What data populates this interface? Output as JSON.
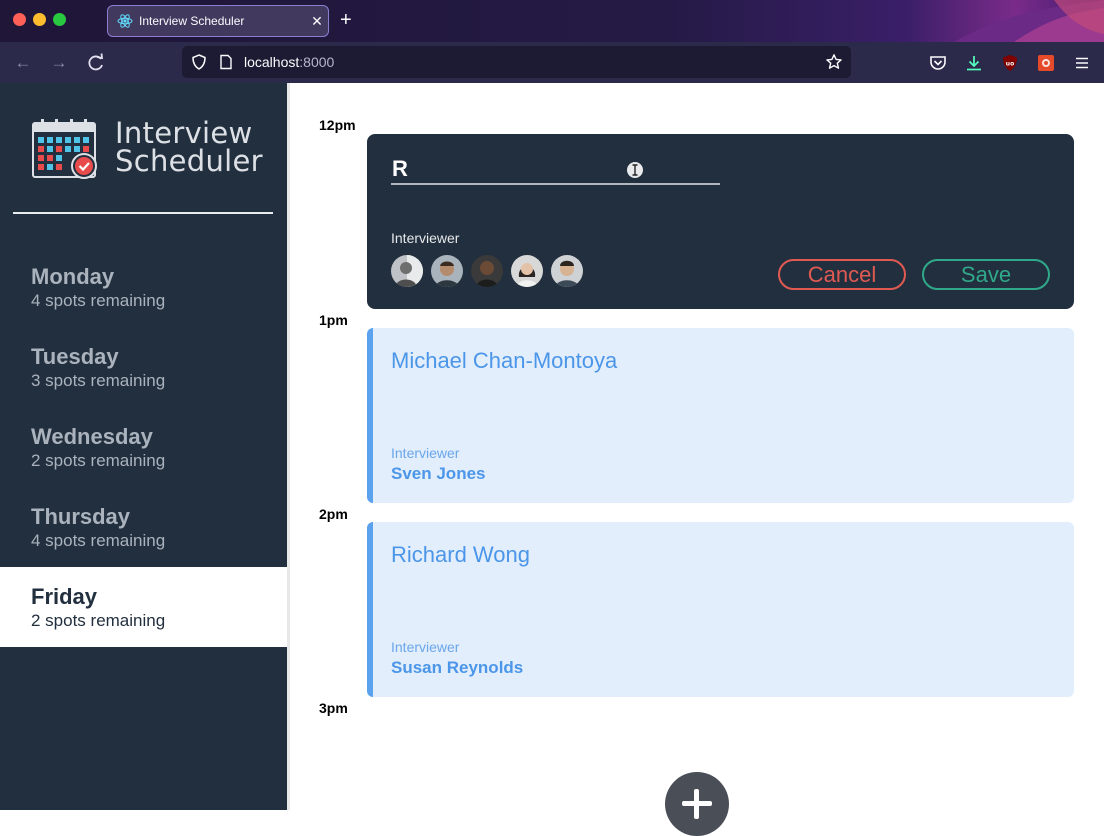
{
  "browser": {
    "tab_title": "Interview Scheduler",
    "url_host": "localhost",
    "url_port": ":8000",
    "new_tab": "+",
    "close_tab": "✕"
  },
  "sidebar": {
    "brand_line1": "Interview",
    "brand_line2": "Scheduler",
    "days": [
      {
        "name": "Monday",
        "spots": "4 spots remaining",
        "selected": false
      },
      {
        "name": "Tuesday",
        "spots": "3 spots remaining",
        "selected": false
      },
      {
        "name": "Wednesday",
        "spots": "2 spots remaining",
        "selected": false
      },
      {
        "name": "Thursday",
        "spots": "4 spots remaining",
        "selected": false
      },
      {
        "name": "Friday",
        "spots": "2 spots remaining",
        "selected": true
      }
    ]
  },
  "schedule": {
    "times": [
      "12pm",
      "1pm",
      "2pm",
      "3pm"
    ],
    "form": {
      "student_value": "R",
      "interviewer_label": "Interviewer",
      "cancel_label": "Cancel",
      "save_label": "Save"
    },
    "appointments": [
      {
        "student": "Michael Chan-Montoya",
        "interviewer_label": "Interviewer",
        "interviewer": "Sven Jones"
      },
      {
        "student": "Richard Wong",
        "interviewer_label": "Interviewer",
        "interviewer": "Susan Reynolds"
      }
    ]
  },
  "colors": {
    "sidebar_bg": "#222f3e",
    "appointment_bg": "#e3eefc",
    "appointment_accent": "#5aa2ee",
    "cancel": "#e05a52",
    "save": "#2fa98a"
  }
}
